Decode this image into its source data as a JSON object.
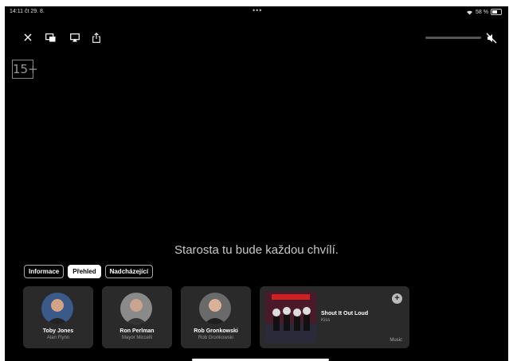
{
  "status": {
    "time": "14:11  čt 29. 8.",
    "dots": "•••",
    "battery": "58 %"
  },
  "rating": "15+",
  "subtitle": "Starosta tu bude každou chvílí.",
  "tabs": [
    {
      "label": "Informace",
      "active": false
    },
    {
      "label": "Přehled",
      "active": true
    },
    {
      "label": "Nadcházející",
      "active": false
    }
  ],
  "volume": {
    "level": 0.0
  },
  "cast": [
    {
      "name": "Toby Jones",
      "role": "Alan Flynn"
    },
    {
      "name": "Ron Perlman",
      "role": "Mayor Miccelli"
    },
    {
      "name": "Rob Gronkowski",
      "role": "Rob Gronkowski"
    }
  ],
  "music": {
    "song": "Shout It Out Loud",
    "artist": "Kiss",
    "brand": "Music",
    "plus": "+"
  }
}
